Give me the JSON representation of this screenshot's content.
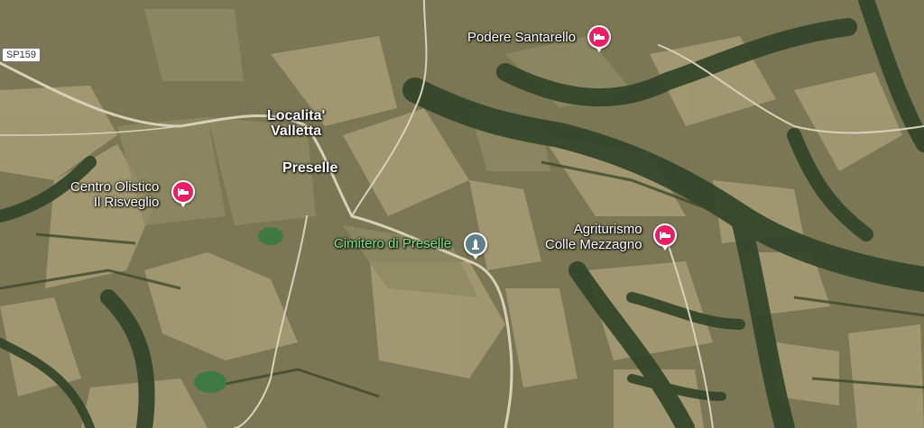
{
  "road_shield": "SP159",
  "places": {
    "podere": "Podere Santarello",
    "localita_line1": "Localita'",
    "localita_line2": "Valletta",
    "preselle": "Preselle",
    "centro_line1": "Centro Olistico",
    "centro_line2": "Il Risveglio",
    "cimitero": "Cimitero di Preselle",
    "agri_line1": "Agriturismo",
    "agri_line2": "Colle Mezzagno"
  },
  "icons": {
    "lodging": "bed-icon",
    "cemetery": "monument-icon"
  },
  "colors": {
    "lodging_pin": "#e91e63",
    "cemetery_pin": "#5f7f8a",
    "park_label": "#7fe38a"
  }
}
